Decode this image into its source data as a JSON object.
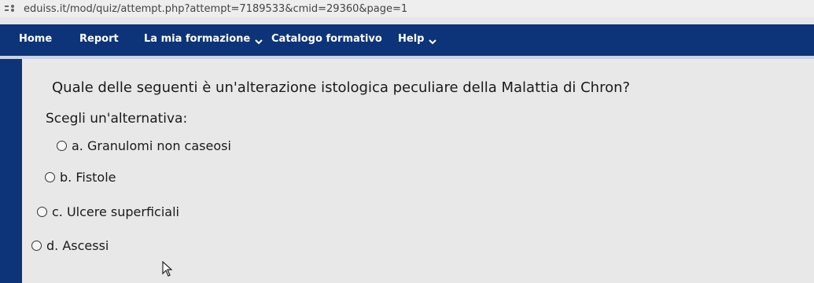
{
  "browser": {
    "url": "eduiss.it/mod/quiz/attempt.php?attempt=7189533&cmid=29360&page=1"
  },
  "navbar": {
    "items": [
      {
        "label": "Home",
        "has_dropdown": false
      },
      {
        "label": "Report",
        "has_dropdown": false
      },
      {
        "label": "La mia formazione",
        "has_dropdown": true
      },
      {
        "label": "Catalogo formativo",
        "has_dropdown": false
      },
      {
        "label": "Help",
        "has_dropdown": true
      }
    ]
  },
  "quiz": {
    "question": "Quale delle seguenti è un'alterazione istologica peculiare della Malattia di Chron?",
    "prompt": "Scegli un'alternativa:",
    "options": [
      {
        "label": "a. Granulomi non caseosi",
        "selected": false
      },
      {
        "label": "b. Fistole",
        "selected": false
      },
      {
        "label": "c. Ulcere superficiali",
        "selected": false
      },
      {
        "label": "d. Ascessi",
        "selected": false
      }
    ]
  },
  "colors": {
    "nav_background": "#0d3478",
    "nav_text": "#ffffff",
    "page_background": "#e8e8e8"
  },
  "icons": {
    "chevron": "chevron-down-icon",
    "radio": "radio-button-icon",
    "cursor": "mouse-pointer-icon"
  }
}
